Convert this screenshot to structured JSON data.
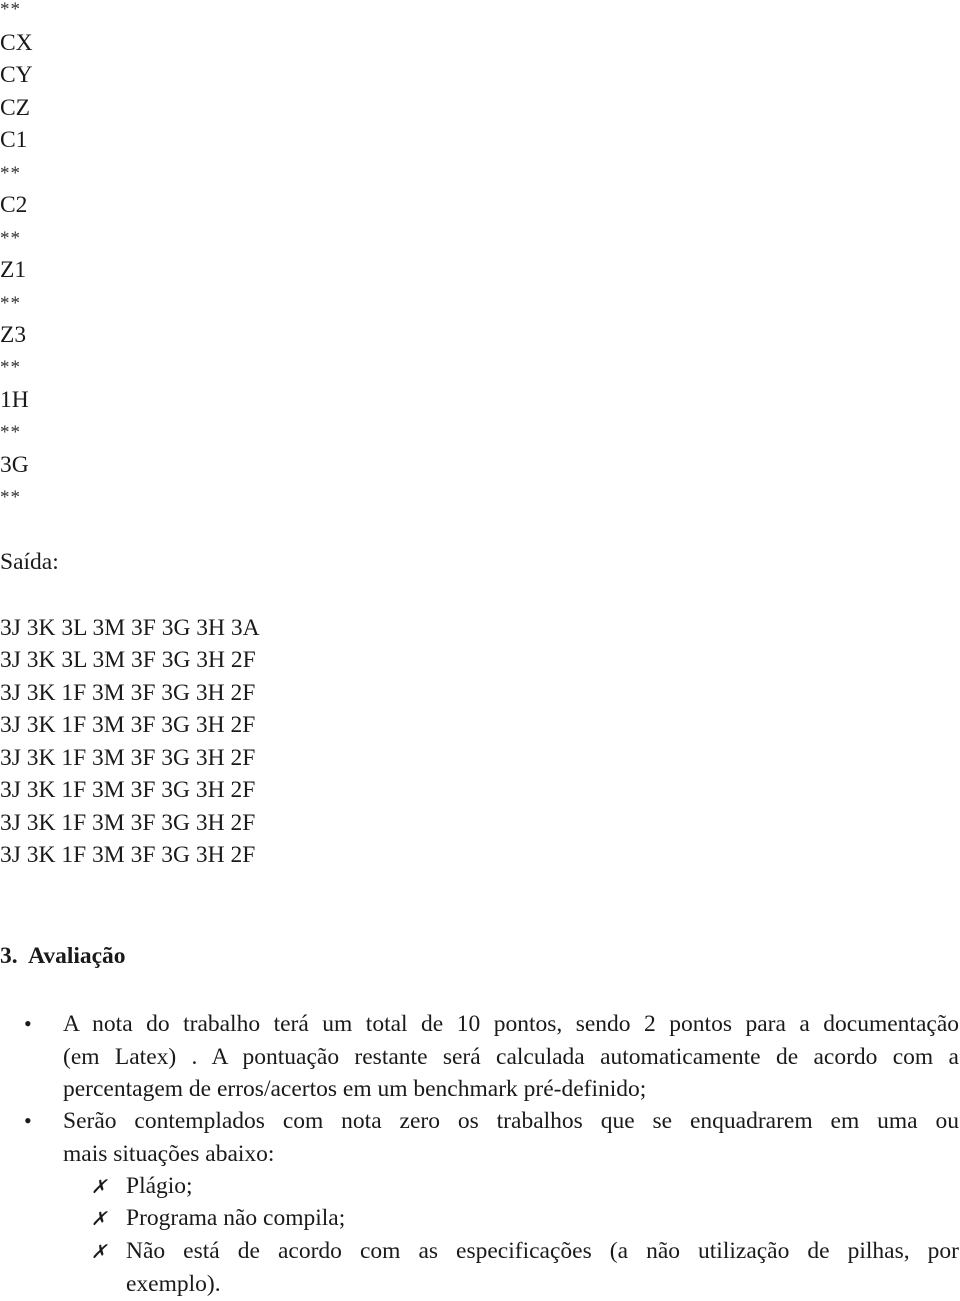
{
  "input_lines": [
    "**",
    "CX",
    "CY",
    "CZ",
    "C1",
    "**",
    "C2",
    "**",
    "Z1",
    "**",
    "Z3",
    "**",
    "1H",
    "**",
    "3G",
    "**"
  ],
  "output_label": "Saída:",
  "output_lines": [
    "3J 3K 3L 3M 3F 3G 3H 3A",
    "3J 3K 3L 3M 3F 3G 3H 2F",
    "3J 3K 1F 3M 3F 3G 3H 2F",
    "3J 3K 1F 3M 3F 3G 3H 2F",
    "3J 3K 1F 3M 3F 3G 3H 2F",
    "3J 3K 1F 3M 3F 3G 3H 2F",
    "3J 3K 1F 3M 3F 3G 3H 2F",
    "3J 3K 1F 3M 3F 3G 3H 2F"
  ],
  "section": {
    "number": "3.",
    "title": "Avaliação",
    "bullet_glyph": "•",
    "bullets": [
      {
        "lines": [
          "A nota do trabalho terá um total de 10 pontos, sendo 2 pontos para a documentação",
          "(em Latex) . A pontuação restante será calculada automaticamente de acordo com a",
          "percentagem de erros/acertos em um benchmark pré-definido;"
        ]
      },
      {
        "lines": [
          "Serão contemplados com nota zero os trabalhos que se enquadrarem em uma ou",
          "mais situações abaixo:"
        ],
        "subitem_glyph": "✗",
        "subitems": [
          {
            "lines": [
              "Plágio;"
            ]
          },
          {
            "lines": [
              "Programa não compila;"
            ]
          },
          {
            "lines": [
              "Não está de acordo com as especificações (a não utilização de pilhas, por",
              "exemplo)."
            ]
          }
        ]
      }
    ]
  }
}
